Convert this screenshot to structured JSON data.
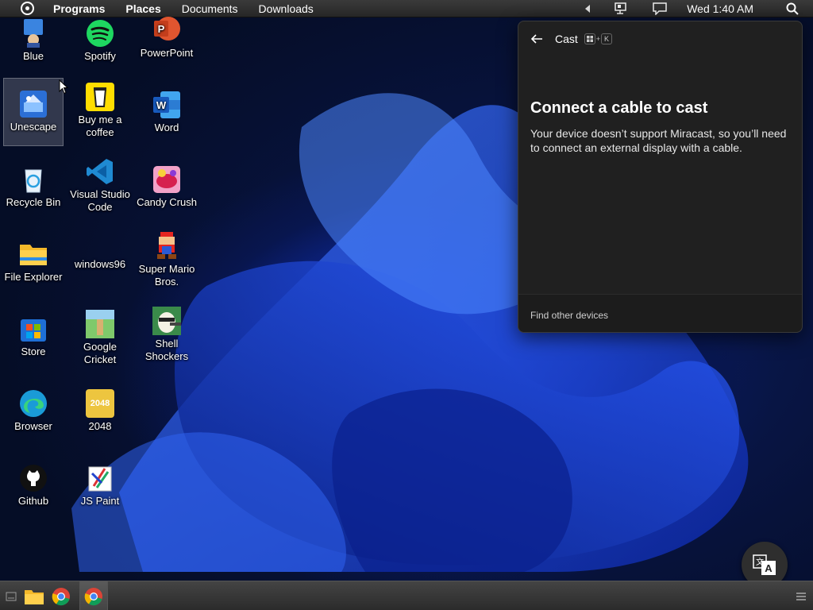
{
  "topbar": {
    "menus": [
      "Programs",
      "Places",
      "Documents",
      "Downloads"
    ],
    "clock": "Wed 1:40 AM"
  },
  "desktop": {
    "icons": [
      {
        "label": "Blue"
      },
      {
        "label": "Spotify"
      },
      {
        "label": "PowerPoint"
      },
      {
        "label": "Unescape"
      },
      {
        "label": "Buy me a coffee"
      },
      {
        "label": "Word"
      },
      {
        "label": "Recycle Bin"
      },
      {
        "label": "Visual Studio Code"
      },
      {
        "label": "Candy Crush"
      },
      {
        "label": "File Explorer"
      },
      {
        "label": "windows96"
      },
      {
        "label": "Super Mario Bros."
      },
      {
        "label": "Store"
      },
      {
        "label": "Google Cricket"
      },
      {
        "label": "Shell Shockers"
      },
      {
        "label": "Browser"
      },
      {
        "label": "2048"
      },
      {
        "label": "Github"
      },
      {
        "label": "JS Paint"
      }
    ],
    "tile_2048": "2048"
  },
  "cast_panel": {
    "header_title": "Cast",
    "shortcut_key": "K",
    "heading": "Connect a cable to cast",
    "description": "Your device doesn’t support Miracast, so you’ll need to connect an external display with a cable.",
    "footer_link": "Find other devices"
  },
  "colors": {
    "accent_blue": "#1a3fd8",
    "panel_bg": "#202020",
    "taskbar_bg": "#2b2b2b"
  }
}
